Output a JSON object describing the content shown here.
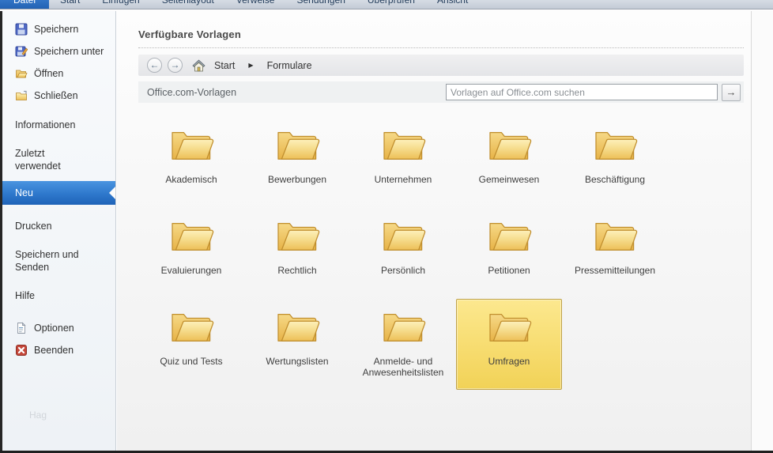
{
  "tabs": [
    {
      "label": "Datei",
      "active": true
    },
    {
      "label": "Start",
      "active": false
    },
    {
      "label": "Einfügen",
      "active": false
    },
    {
      "label": "Seitenlayout",
      "active": false
    },
    {
      "label": "Verweise",
      "active": false
    },
    {
      "label": "Sendungen",
      "active": false
    },
    {
      "label": "Überprüfen",
      "active": false
    },
    {
      "label": "Ansicht",
      "active": false
    }
  ],
  "sidebar": {
    "save": "Speichern",
    "save_as": "Speichern unter",
    "open": "Öffnen",
    "close": "Schließen",
    "info": "Informationen",
    "recent": "Zuletzt verwendet",
    "new": "Neu",
    "print": "Drucken",
    "save_send": "Speichern und Senden",
    "help": "Hilfe",
    "options": "Optionen",
    "exit": "Beenden",
    "watermark": "Hag"
  },
  "main": {
    "title": "Verfügbare Vorlagen",
    "breadcrumb": {
      "root": "Start",
      "current": "Formulare"
    },
    "office_bar": {
      "label": "Office.com-Vorlagen",
      "search_placeholder": "Vorlagen auf Office.com suchen",
      "go_glyph": "→"
    },
    "nav": {
      "back_glyph": "←",
      "forward_glyph": "→",
      "sep_glyph": "▶"
    },
    "folders": [
      {
        "label": "Akademisch",
        "selected": false
      },
      {
        "label": "Bewerbungen",
        "selected": false
      },
      {
        "label": "Unternehmen",
        "selected": false
      },
      {
        "label": "Gemeinwesen",
        "selected": false
      },
      {
        "label": "Beschäftigung",
        "selected": false
      },
      {
        "label": "Evaluierungen",
        "selected": false
      },
      {
        "label": "Rechtlich",
        "selected": false
      },
      {
        "label": "Persönlich",
        "selected": false
      },
      {
        "label": "Petitionen",
        "selected": false
      },
      {
        "label": "Pressemitteilungen",
        "selected": false
      },
      {
        "label": "Quiz und Tests",
        "selected": false
      },
      {
        "label": "Wertungslisten",
        "selected": false
      },
      {
        "label": "Anmelde- und Anwesenheitslisten",
        "selected": false
      },
      {
        "label": "Umfragen",
        "selected": true
      }
    ]
  },
  "colors": {
    "accent_blue": "#2e78cc",
    "selection_gold": "#f7dc6f",
    "folder_gold": "#eec05a",
    "tabstrip_bg": "#c9d1dc"
  }
}
